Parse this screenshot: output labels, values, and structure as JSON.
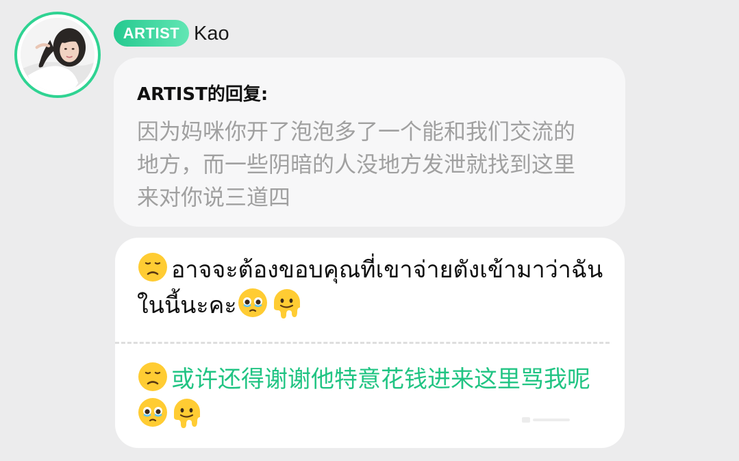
{
  "author": {
    "badge": "ARTIST",
    "name": "Kao",
    "avatar_icon": "profile-photo"
  },
  "quote": {
    "title": "ARTIST的回复:",
    "body": "因为妈咪你开了泡泡多了一个能和我们交流的地方，而一些阴暗的人没地方发泄就找到这里来对你说三道四"
  },
  "reply": {
    "original_text": "อาจจะต้องขอบคุณที่เขาจ่ายตังเข้ามาว่าฉันในนี้นะคะ",
    "translated_text": "或许还得谢谢他特意花钱进来这里骂我呢",
    "emojis": [
      "disappointed-face",
      "face-holding-back-tears",
      "melting-face"
    ]
  },
  "colors": {
    "accent": "#21c483",
    "badge_gradient_start": "#25c98f",
    "badge_gradient_end": "#62e6b4",
    "background": "#ececed",
    "quote_text": "#a0a0a0"
  }
}
